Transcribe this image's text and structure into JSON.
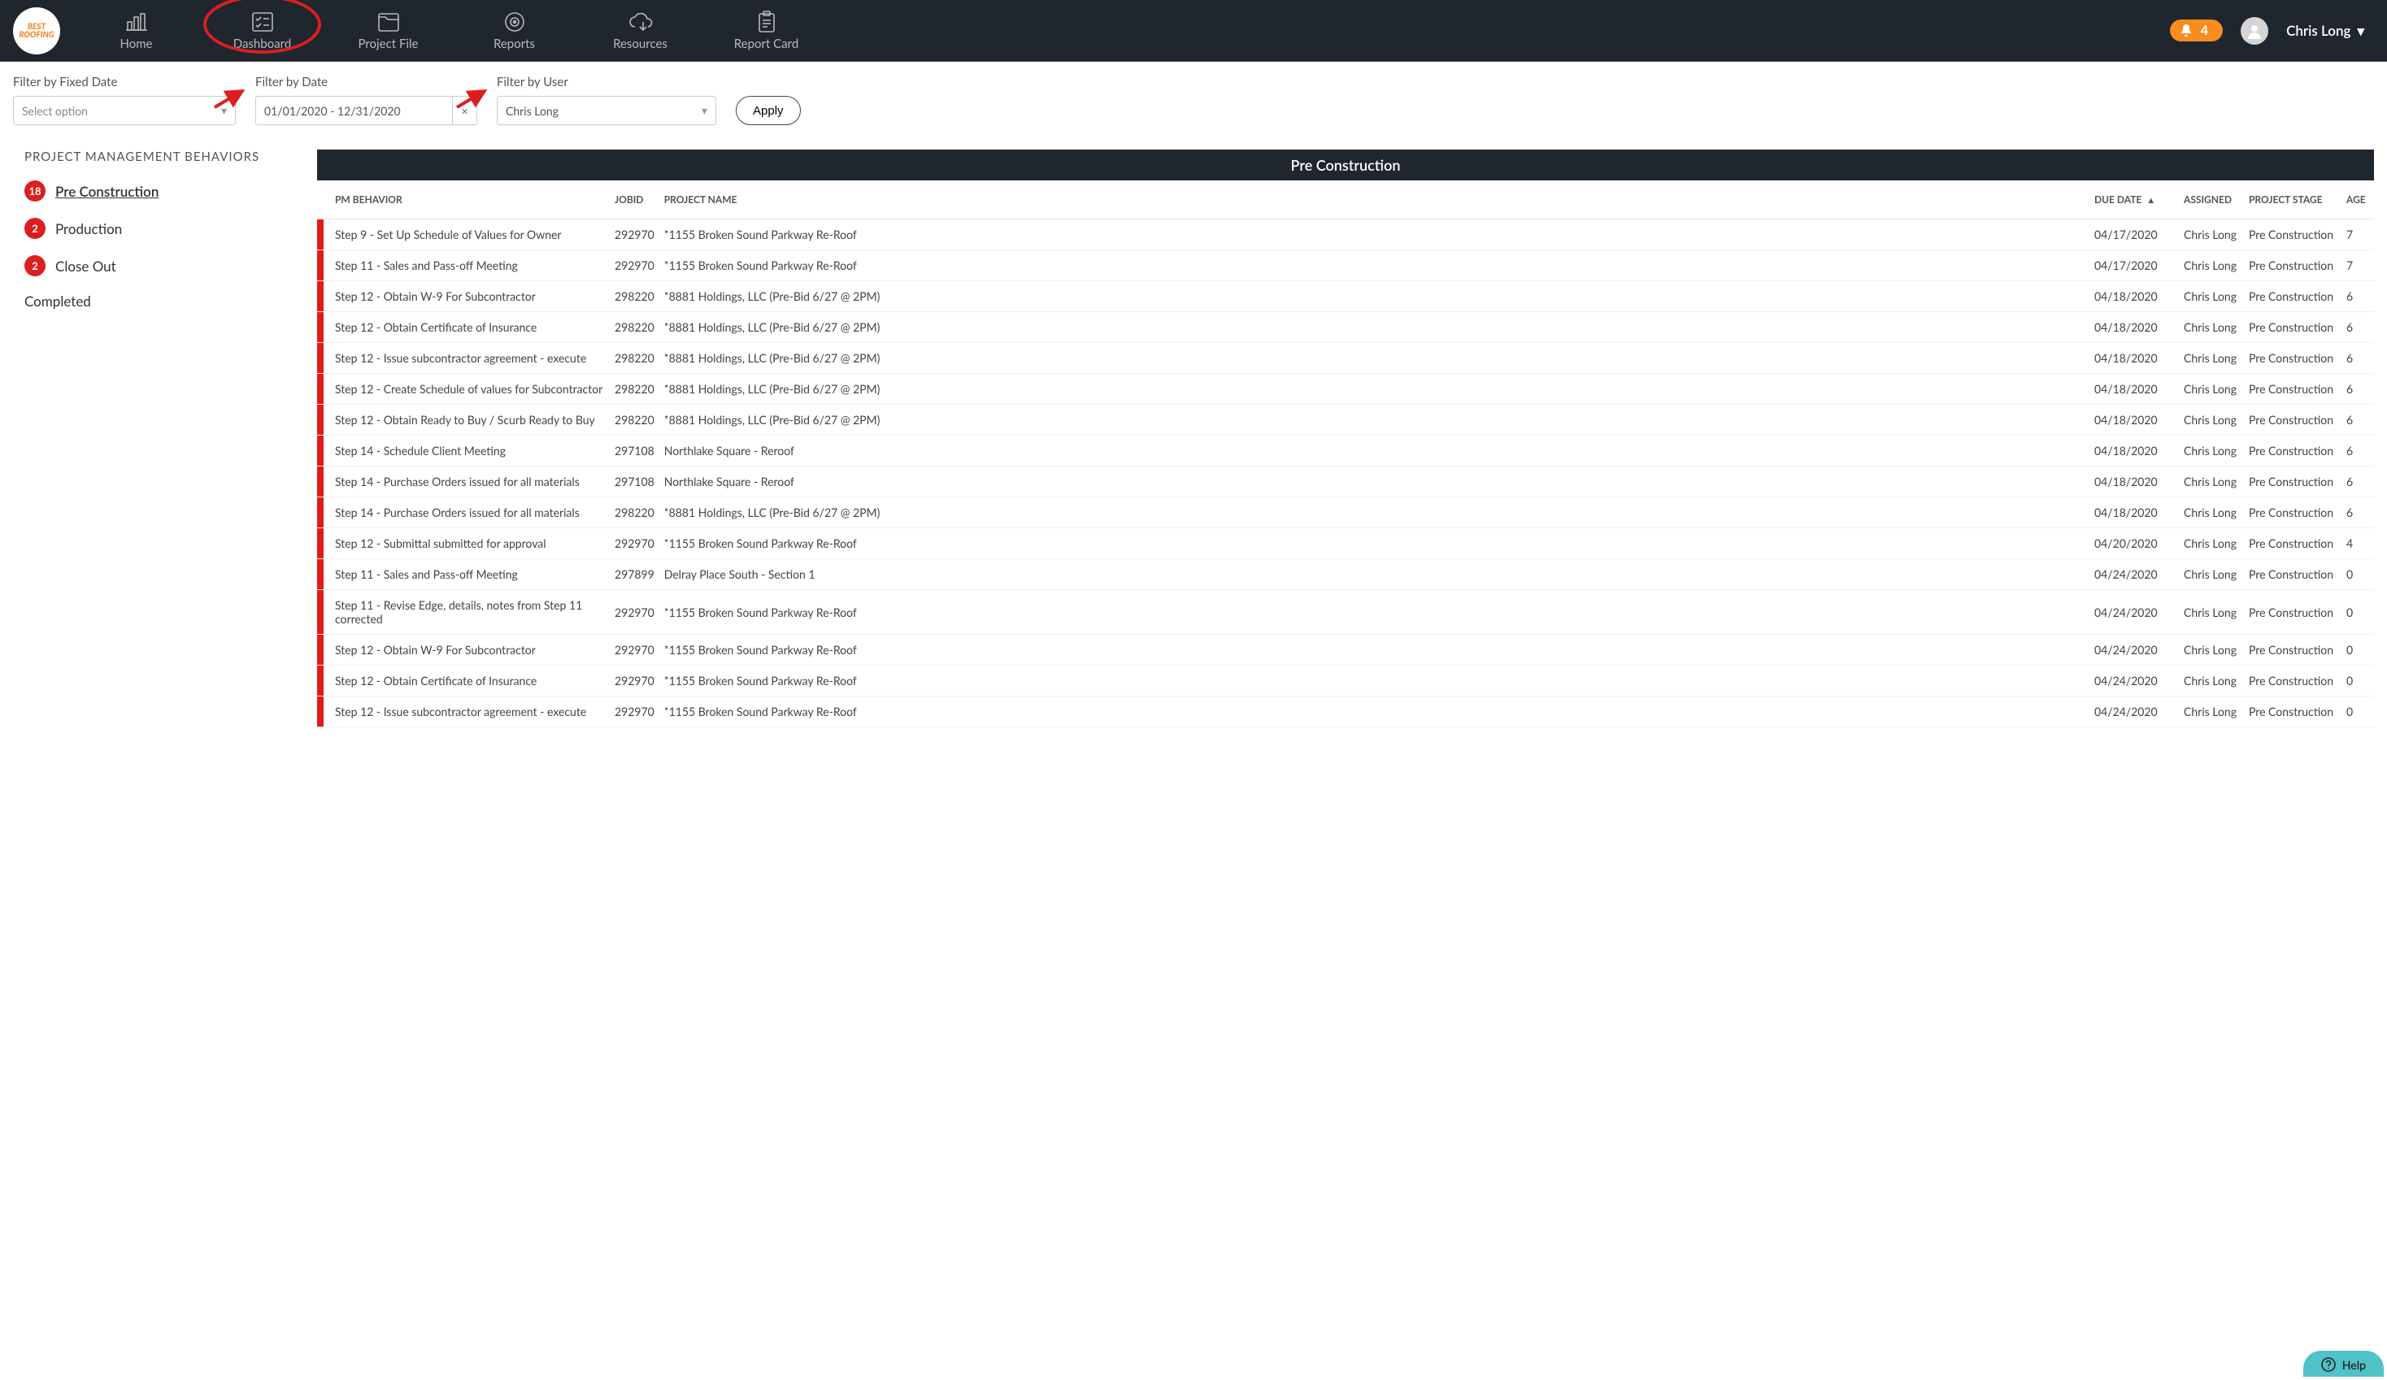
{
  "brand": {
    "logo_text": "BEST ROOFING"
  },
  "nav": {
    "items": [
      {
        "label": "Home"
      },
      {
        "label": "Dashboard"
      },
      {
        "label": "Project File"
      },
      {
        "label": "Reports"
      },
      {
        "label": "Resources"
      },
      {
        "label": "Report Card"
      }
    ],
    "active_index": 1
  },
  "notifications": {
    "count": "4"
  },
  "user": {
    "name": "Chris Long"
  },
  "filters": {
    "fixed_date": {
      "label": "Filter by Fixed Date",
      "placeholder": "Select option"
    },
    "date": {
      "label": "Filter by Date",
      "value": "01/01/2020 - 12/31/2020",
      "clear": "×"
    },
    "user": {
      "label": "Filter by User",
      "value": "Chris Long"
    },
    "apply_label": "Apply"
  },
  "sidebar": {
    "title": "PROJECT MANAGEMENT BEHAVIORS",
    "items": [
      {
        "count": "18",
        "label": "Pre Construction",
        "active": true
      },
      {
        "count": "2",
        "label": "Production"
      },
      {
        "count": "2",
        "label": "Close Out"
      },
      {
        "count": null,
        "label": "Completed"
      }
    ]
  },
  "section": {
    "title": "Pre Construction"
  },
  "columns": {
    "pm_behavior": "PM BEHAVIOR",
    "jobid": "JOBID",
    "project_name": "PROJECT NAME",
    "due_date": "DUE DATE",
    "assigned": "ASSIGNED",
    "project_stage": "PROJECT STAGE",
    "age": "AGE"
  },
  "rows": [
    {
      "behavior": "Step 9 - Set Up Schedule of Values for Owner",
      "jobid": "292970",
      "project": "*1155 Broken Sound Parkway Re-Roof",
      "due": "04/17/2020",
      "assigned": "Chris Long",
      "stage": "Pre Construction",
      "age": "7"
    },
    {
      "behavior": "Step 11 - Sales and Pass-off Meeting",
      "jobid": "292970",
      "project": "*1155 Broken Sound Parkway Re-Roof",
      "due": "04/17/2020",
      "assigned": "Chris Long",
      "stage": "Pre Construction",
      "age": "7"
    },
    {
      "behavior": "Step 12 - Obtain W-9 For Subcontractor",
      "jobid": "298220",
      "project": "*8881 Holdings, LLC (Pre-Bid 6/27 @ 2PM)",
      "due": "04/18/2020",
      "assigned": "Chris Long",
      "stage": "Pre Construction",
      "age": "6"
    },
    {
      "behavior": "Step 12 - Obtain Certificate of Insurance",
      "jobid": "298220",
      "project": "*8881 Holdings, LLC (Pre-Bid 6/27 @ 2PM)",
      "due": "04/18/2020",
      "assigned": "Chris Long",
      "stage": "Pre Construction",
      "age": "6"
    },
    {
      "behavior": "Step 12 - Issue subcontractor agreement - execute",
      "jobid": "298220",
      "project": "*8881 Holdings, LLC (Pre-Bid 6/27 @ 2PM)",
      "due": "04/18/2020",
      "assigned": "Chris Long",
      "stage": "Pre Construction",
      "age": "6"
    },
    {
      "behavior": "Step 12 - Create Schedule of values for Subcontractor",
      "jobid": "298220",
      "project": "*8881 Holdings, LLC (Pre-Bid 6/27 @ 2PM)",
      "due": "04/18/2020",
      "assigned": "Chris Long",
      "stage": "Pre Construction",
      "age": "6"
    },
    {
      "behavior": "Step 12 - Obtain Ready to Buy / Scurb Ready to Buy",
      "jobid": "298220",
      "project": "*8881 Holdings, LLC (Pre-Bid 6/27 @ 2PM)",
      "due": "04/18/2020",
      "assigned": "Chris Long",
      "stage": "Pre Construction",
      "age": "6"
    },
    {
      "behavior": "Step 14 - Schedule Client Meeting",
      "jobid": "297108",
      "project": "Northlake Square - Reroof",
      "due": "04/18/2020",
      "assigned": "Chris Long",
      "stage": "Pre Construction",
      "age": "6"
    },
    {
      "behavior": "Step 14 - Purchase Orders issued for all materials",
      "jobid": "297108",
      "project": "Northlake Square - Reroof",
      "due": "04/18/2020",
      "assigned": "Chris Long",
      "stage": "Pre Construction",
      "age": "6"
    },
    {
      "behavior": "Step 14 - Purchase Orders issued for all materials",
      "jobid": "298220",
      "project": "*8881 Holdings, LLC (Pre-Bid 6/27 @ 2PM)",
      "due": "04/18/2020",
      "assigned": "Chris Long",
      "stage": "Pre Construction",
      "age": "6"
    },
    {
      "behavior": "Step 12 - Submittal submitted for approval",
      "jobid": "292970",
      "project": "*1155 Broken Sound Parkway Re-Roof",
      "due": "04/20/2020",
      "assigned": "Chris Long",
      "stage": "Pre Construction",
      "age": "4"
    },
    {
      "behavior": "Step 11 - Sales and Pass-off Meeting",
      "jobid": "297899",
      "project": "Delray Place South - Section 1",
      "due": "04/24/2020",
      "assigned": "Chris Long",
      "stage": "Pre Construction",
      "age": "0"
    },
    {
      "behavior": "Step 11 - Revise Edge, details, notes from Step 11 corrected",
      "jobid": "292970",
      "project": "*1155 Broken Sound Parkway Re-Roof",
      "due": "04/24/2020",
      "assigned": "Chris Long",
      "stage": "Pre Construction",
      "age": "0"
    },
    {
      "behavior": "Step 12 - Obtain W-9 For Subcontractor",
      "jobid": "292970",
      "project": "*1155 Broken Sound Parkway Re-Roof",
      "due": "04/24/2020",
      "assigned": "Chris Long",
      "stage": "Pre Construction",
      "age": "0"
    },
    {
      "behavior": "Step 12 - Obtain Certificate of Insurance",
      "jobid": "292970",
      "project": "*1155 Broken Sound Parkway Re-Roof",
      "due": "04/24/2020",
      "assigned": "Chris Long",
      "stage": "Pre Construction",
      "age": "0"
    },
    {
      "behavior": "Step 12 - Issue subcontractor agreement - execute",
      "jobid": "292970",
      "project": "*1155 Broken Sound Parkway Re-Roof",
      "due": "04/24/2020",
      "assigned": "Chris Long",
      "stage": "Pre Construction",
      "age": "0"
    }
  ],
  "help": {
    "label": "Help"
  }
}
